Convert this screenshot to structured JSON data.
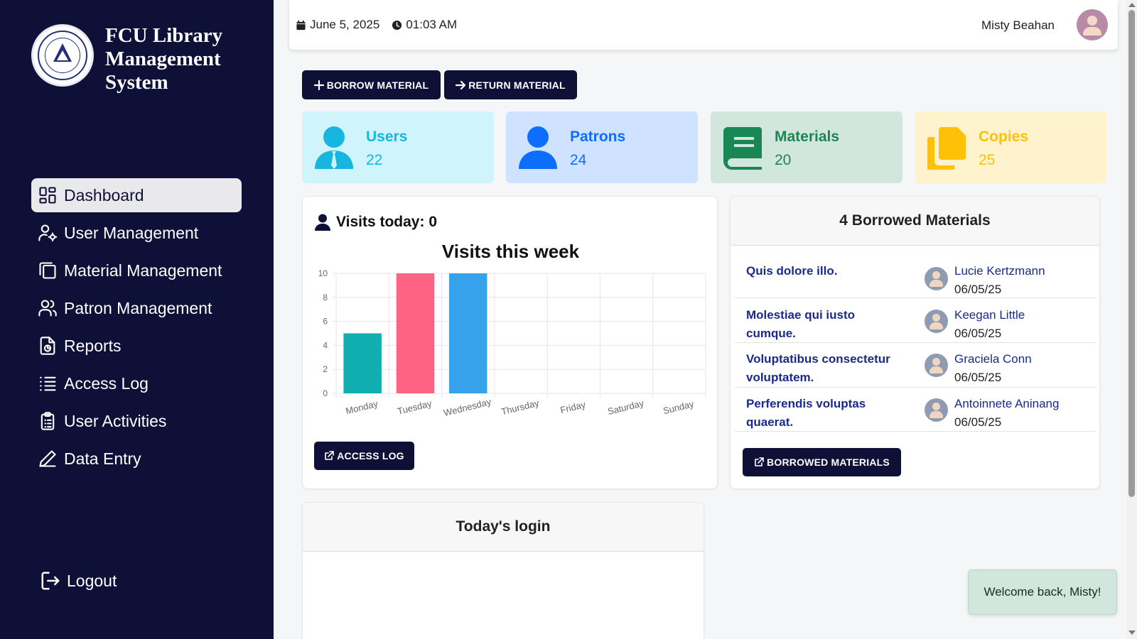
{
  "brand": {
    "title": "FCU Library Management System"
  },
  "sidebar": {
    "items": [
      {
        "label": "Dashboard",
        "icon": "dashboard-icon",
        "active": true
      },
      {
        "label": "User Management",
        "icon": "user-gear-icon"
      },
      {
        "label": "Material Management",
        "icon": "copy-icon"
      },
      {
        "label": "Patron Management",
        "icon": "people-icon"
      },
      {
        "label": "Reports",
        "icon": "file-chart-icon"
      },
      {
        "label": "Access Log",
        "icon": "list-icon"
      },
      {
        "label": "User Activities",
        "icon": "clipboard-icon"
      },
      {
        "label": "Data Entry",
        "icon": "pencil-icon"
      }
    ],
    "logout": "Logout"
  },
  "topbar": {
    "date": "June 5, 2025",
    "time": "01:03 AM",
    "user_name": "Misty Beahan"
  },
  "actions": {
    "borrow": "BORROW MATERIAL",
    "return": "RETURN MATERIAL"
  },
  "stats": [
    {
      "label": "Users",
      "value": "22",
      "color": "#17b6e0",
      "bg": "#cff4fc"
    },
    {
      "label": "Patrons",
      "value": "24",
      "color": "#0d6efd",
      "bg": "#cfe2ff"
    },
    {
      "label": "Materials",
      "value": "20",
      "color": "#198754",
      "bg": "#d1e7dd"
    },
    {
      "label": "Copies",
      "value": "25",
      "color": "#ffc107",
      "bg": "#fff3cd"
    }
  ],
  "visits": {
    "today_label": "Visits today: 0",
    "access_log_button": "ACCESS LOG"
  },
  "chart_data": {
    "type": "bar",
    "title": "Visits this week",
    "categories": [
      "Monday",
      "Tuesday",
      "Wednesday",
      "Thursday",
      "Friday",
      "Saturday",
      "Sunday"
    ],
    "values": [
      5,
      10,
      10,
      0,
      0,
      0,
      0
    ],
    "colors": [
      "#11aeb0",
      "#ff6384",
      "#36a2eb",
      "#ff9f40",
      "#9966ff",
      "#ffcd56",
      "#c9cbcf"
    ],
    "ylim": [
      0,
      10
    ],
    "yticks": [
      "0",
      "2",
      "4",
      "6",
      "8",
      "10"
    ],
    "grid": true
  },
  "borrowed": {
    "header": "4 Borrowed Materials",
    "rows": [
      {
        "title": "Quis dolore illo.",
        "patron": "Lucie Kertzmann",
        "date": "06/05/25"
      },
      {
        "title": "Molestiae qui iusto cumque.",
        "patron": "Keegan Little",
        "date": "06/05/25"
      },
      {
        "title": "Voluptatibus consectetur voluptatem.",
        "patron": "Graciela Conn",
        "date": "06/05/25"
      },
      {
        "title": "Perferendis voluptas quaerat.",
        "patron": "Antoinnete Aninang",
        "date": "06/05/25"
      }
    ],
    "button": "BORROWED MATERIALS"
  },
  "login": {
    "header": "Today's login"
  },
  "toast": {
    "text": "Welcome back, Misty!"
  }
}
